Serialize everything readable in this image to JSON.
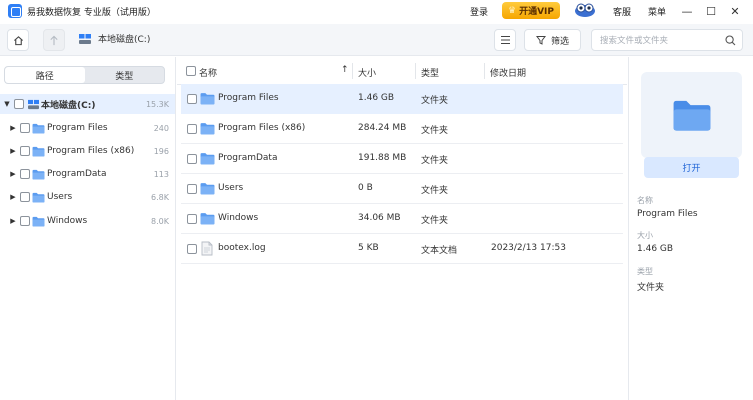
{
  "titlebar": {
    "app_title": "易我数据恢复 专业版（试用版）",
    "login": "登录",
    "vip": "开通VIP",
    "support": "客服",
    "menu": "菜单",
    "minimize": "—",
    "maximize": "☐",
    "close": "✕"
  },
  "toolbar": {
    "path": "本地磁盘(C:)",
    "filter_label": "筛选",
    "search_placeholder": "搜索文件或文件夹"
  },
  "left": {
    "tabs": [
      "路径",
      "类型"
    ],
    "root": {
      "label": "本地磁盘(C:)",
      "count": "15.3K"
    },
    "items": [
      {
        "label": "Program Files",
        "count": "240"
      },
      {
        "label": "Program Files (x86)",
        "count": "196"
      },
      {
        "label": "ProgramData",
        "count": "113"
      },
      {
        "label": "Users",
        "count": "6.8K"
      },
      {
        "label": "Windows",
        "count": "8.0K"
      }
    ]
  },
  "list": {
    "columns": {
      "name": "名称",
      "size": "大小",
      "type": "类型",
      "modified": "修改日期"
    },
    "sort_indicator": "↑",
    "rows": [
      {
        "name": "Program Files",
        "size": "1.46 GB",
        "type": "文件夹",
        "modified": "",
        "icon": "folder-icon"
      },
      {
        "name": "Program Files (x86)",
        "size": "284.24 MB",
        "type": "文件夹",
        "modified": "",
        "icon": "folder-icon"
      },
      {
        "name": "ProgramData",
        "size": "191.88 MB",
        "type": "文件夹",
        "modified": "",
        "icon": "folder-icon"
      },
      {
        "name": "Users",
        "size": "0 B",
        "type": "文件夹",
        "modified": "",
        "icon": "folder-icon"
      },
      {
        "name": "Windows",
        "size": "34.06 MB",
        "type": "文件夹",
        "modified": "",
        "icon": "folder-icon"
      },
      {
        "name": "bootex.log",
        "size": "5 KB",
        "type": "文本文档",
        "modified": "2023/2/13 17:53",
        "icon": "file-icon"
      }
    ]
  },
  "details": {
    "open_button": "打开",
    "name_label": "名称",
    "name_value": "Program Files",
    "size_label": "大小",
    "size_value": "1.46 GB",
    "type_label": "类型",
    "type_value": "文件夹"
  },
  "colors": {
    "accent": "#2f7ff5",
    "folder": "#5b9cf0",
    "selection": "#e6f0ff",
    "vip": "#f6a600"
  }
}
